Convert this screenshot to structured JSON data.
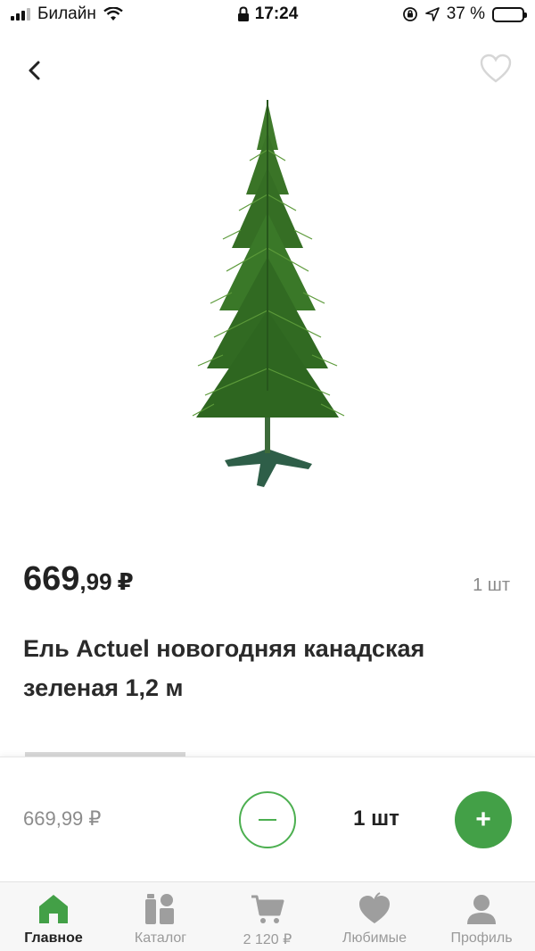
{
  "status_bar": {
    "carrier": "Билайн",
    "time": "17:24",
    "battery": "37 %",
    "battery_level": 0.37
  },
  "header": {
    "back_icon": "chevron-left-icon",
    "favorite_icon": "heart-outline-icon"
  },
  "product": {
    "image_icon": "christmas-tree-image",
    "price_int": "669",
    "price_frac": ",99",
    "currency": "₽",
    "unit": "1 шт",
    "title": "Ель Actuel новогодняя канадская зеленая 1,2 м"
  },
  "purchase_bar": {
    "price": "669,99 ₽",
    "quantity": "1 шт",
    "minus_icon": "minus-icon",
    "plus_label": "+"
  },
  "tabbar": {
    "items": [
      {
        "label": "Главное",
        "icon": "home-icon",
        "active": true
      },
      {
        "label": "Каталог",
        "icon": "catalog-icon",
        "active": false
      },
      {
        "label": "2 120 ₽",
        "icon": "cart-icon",
        "active": false
      },
      {
        "label": "Любимые",
        "icon": "heart-icon",
        "active": false
      },
      {
        "label": "Профиль",
        "icon": "profile-icon",
        "active": false
      }
    ]
  },
  "colors": {
    "accent": "#43a047",
    "icon_inactive": "#9e9e9e",
    "text": "#222222",
    "muted": "#8c8c8c"
  }
}
